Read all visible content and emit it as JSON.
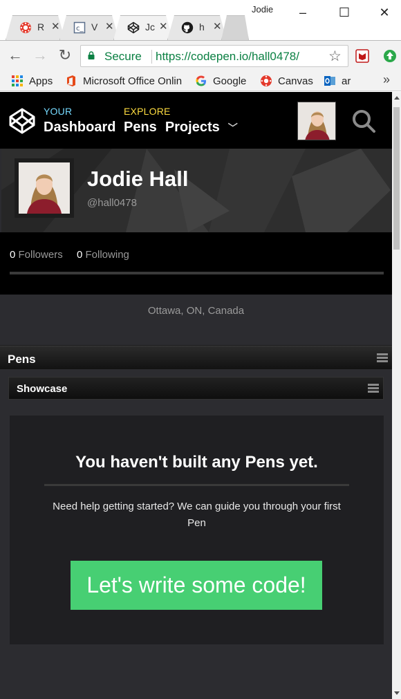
{
  "browser": {
    "profile_name": "Jodie",
    "tabs": [
      {
        "title": "R",
        "icon": "canvas-icon",
        "active": false
      },
      {
        "title": "V",
        "icon": "cs-doc-icon",
        "active": false
      },
      {
        "title": "Jc",
        "icon": "codepen-icon",
        "active": true
      },
      {
        "title": "h",
        "icon": "github-icon",
        "active": false
      }
    ],
    "address": {
      "secure_label": "Secure",
      "url_host": "https://codepen.io",
      "url_path": "/hall0478/"
    },
    "bookmarks": [
      {
        "label": "Apps",
        "icon": "apps-grid-icon"
      },
      {
        "label": "Microsoft Office Onlin",
        "icon": "office-icon"
      },
      {
        "label": "Google",
        "icon": "google-icon"
      },
      {
        "label": "Canvas",
        "icon": "canvas-icon"
      },
      {
        "label": "ar",
        "icon": "outlook-icon"
      }
    ],
    "bookmarks_more": "»"
  },
  "nav": {
    "your_label": "YOUR",
    "dashboard": "Dashboard",
    "explore_label": "EXPLORE",
    "pens": "Pens",
    "projects": "Projects",
    "colors": {
      "your": "#76daff",
      "explore": "#ffdd40"
    }
  },
  "profile": {
    "name": "Jodie Hall",
    "handle": "@hall0478",
    "followers_count": "0",
    "followers_label": "Followers",
    "following_count": "0",
    "following_label": "Following",
    "location": "Ottawa, ON, Canada"
  },
  "sections": {
    "pens_title": "Pens",
    "showcase_title": "Showcase"
  },
  "empty_state": {
    "title": "You haven't built any Pens yet.",
    "help_text": "Need help getting started? We can guide you through your first Pen",
    "cta_label": "Let's write some code!",
    "cta_color": "#47cf73"
  }
}
